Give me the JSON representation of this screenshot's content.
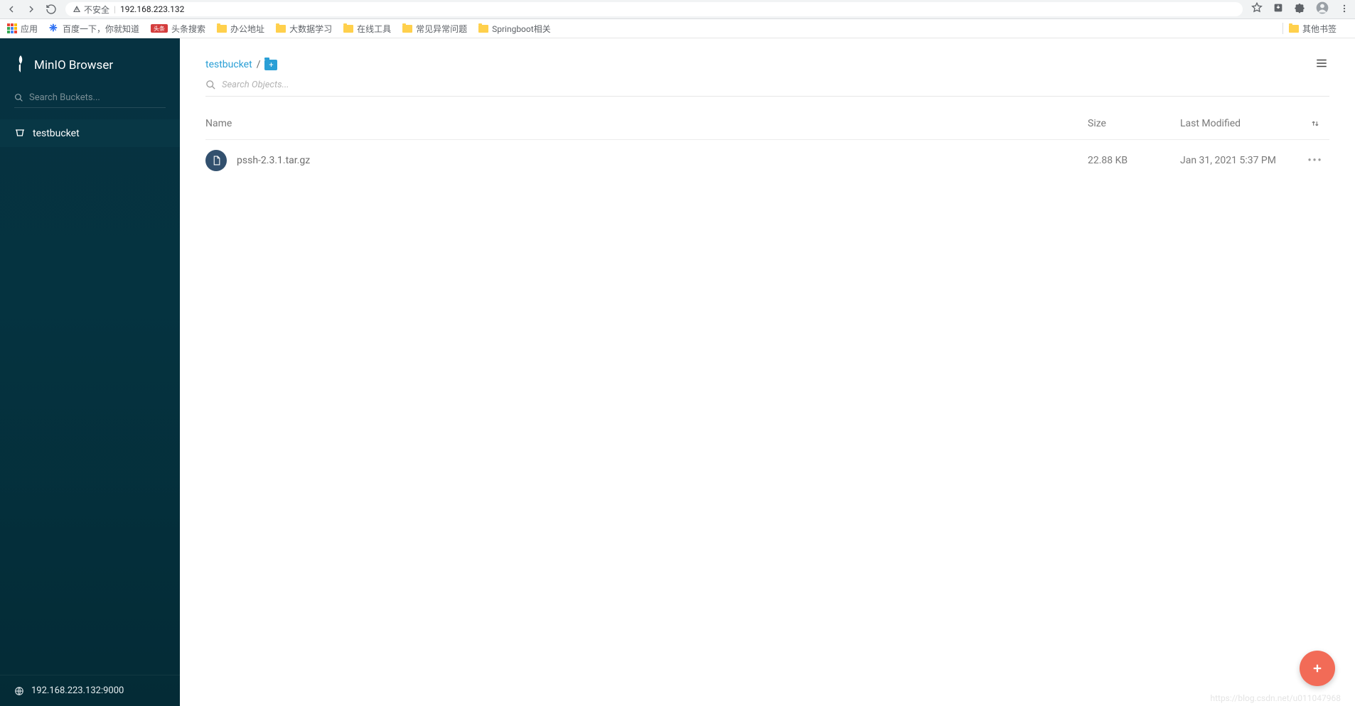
{
  "browser": {
    "security_label": "不安全",
    "url": "192.168.223.132"
  },
  "bookmarks": {
    "apps": "应用",
    "items": [
      "百度一下，你就知道",
      "头条搜索",
      "办公地址",
      "大数据学习",
      "在线工具",
      "常见异常问题",
      "Springboot相关"
    ],
    "other": "其他书签"
  },
  "sidebar": {
    "title": "MinIO Browser",
    "search_placeholder": "Search Buckets...",
    "buckets": [
      "testbucket"
    ],
    "host": "192.168.223.132:9000"
  },
  "main": {
    "breadcrumb_bucket": "testbucket",
    "breadcrumb_sep": "/",
    "objects_search_placeholder": "Search Objects...",
    "columns": {
      "name": "Name",
      "size": "Size",
      "modified": "Last Modified"
    },
    "files": [
      {
        "name": "pssh-2.3.1.tar.gz",
        "size": "22.88 KB",
        "modified": "Jan 31, 2021 5:37 PM"
      }
    ]
  },
  "watermark": "https://blog.csdn.net/u011047968"
}
